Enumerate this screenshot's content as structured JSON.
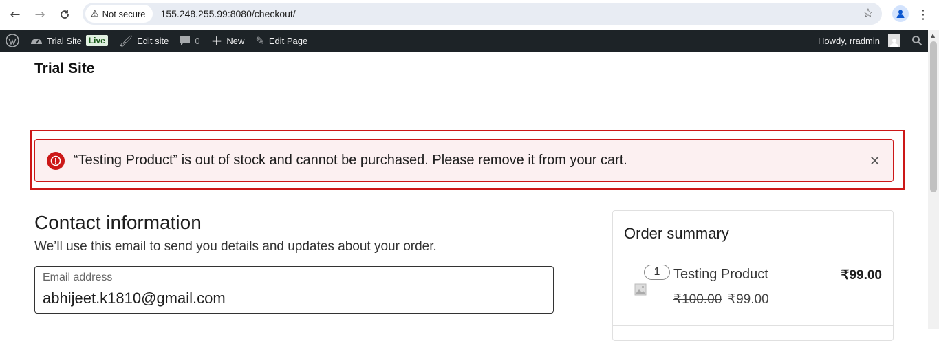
{
  "browser": {
    "security_label": "Not secure",
    "url": "155.248.255.99:8080/checkout/"
  },
  "wp_bar": {
    "site_name": "Trial Site",
    "live_label": "Live",
    "edit_site": "Edit site",
    "comments_count": "0",
    "new_label": "New",
    "edit_page": "Edit Page",
    "howdy": "Howdy, rradmin"
  },
  "page": {
    "site_title": "Trial Site"
  },
  "notice": {
    "message": "“Testing Product” is out of stock and cannot be purchased. Please remove it from your cart.",
    "close_glyph": "×",
    "accent": "#cc1818"
  },
  "contact": {
    "title": "Contact information",
    "description": "We’ll use this email to send you details and updates about your order.",
    "email_label": "Email address",
    "email_value": "abhijeet.k1810@gmail.com"
  },
  "summary": {
    "title": "Order summary",
    "items": [
      {
        "quantity": "1",
        "name": "Testing Product",
        "price": "₹99.00",
        "regular_price": "₹100.00",
        "sale_price": "₹99.00"
      }
    ]
  }
}
